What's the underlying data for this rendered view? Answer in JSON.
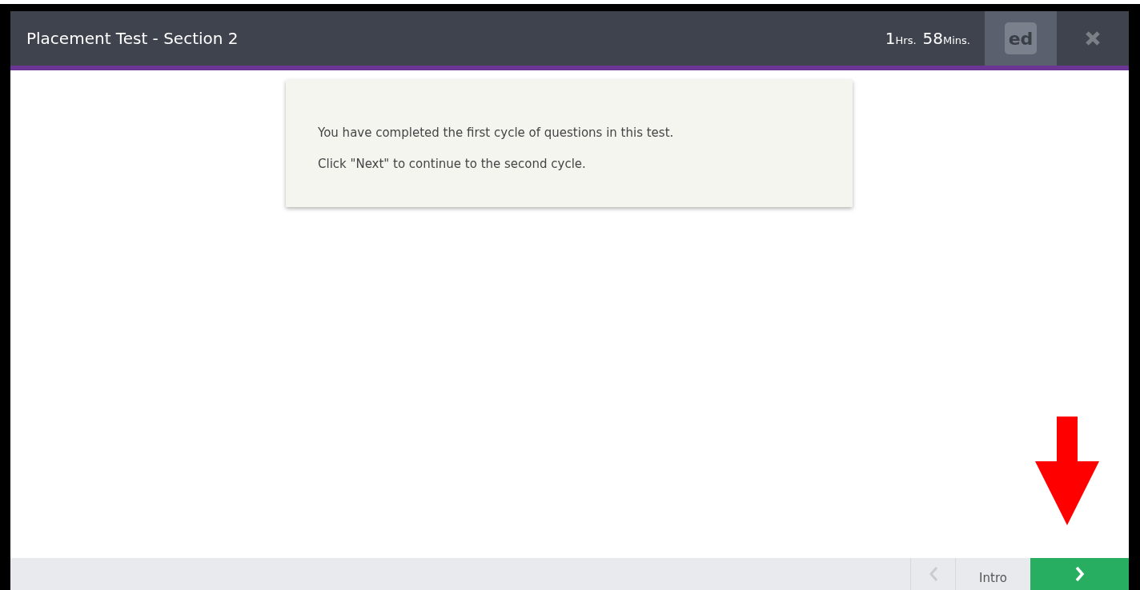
{
  "header": {
    "title": "Placement Test - Section 2",
    "timer": [
      {
        "value": "1",
        "unit": "Hrs."
      },
      {
        "value": "58",
        "unit": "Mins."
      }
    ],
    "logo": "ed"
  },
  "message": [
    "You have completed the first cycle of questions in this test.",
    "Click \"Next\" to continue to the second cycle."
  ],
  "footer": {
    "previous": {
      "disabled": true
    },
    "intro": "Intro",
    "next": {
      "disabled": false
    }
  }
}
